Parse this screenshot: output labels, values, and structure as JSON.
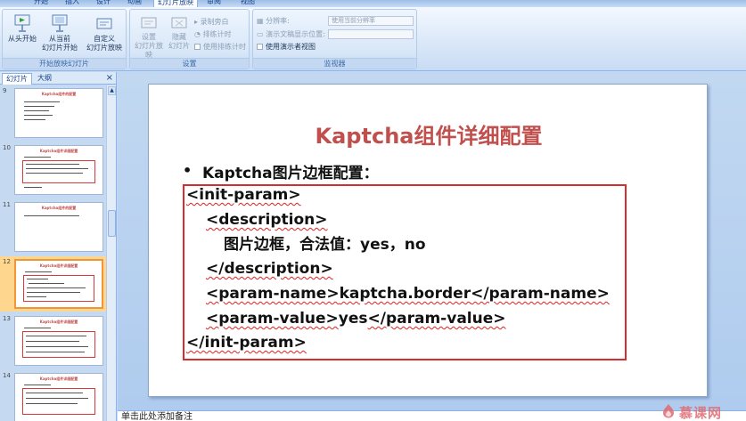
{
  "ribbon_tabs": [
    {
      "label": "开始",
      "active": false
    },
    {
      "label": "插入",
      "active": false
    },
    {
      "label": "设计",
      "active": false
    },
    {
      "label": "动画",
      "active": false
    },
    {
      "label": "幻灯片放映",
      "active": true
    },
    {
      "label": "审阅",
      "active": false
    },
    {
      "label": "视图",
      "active": false
    }
  ],
  "ribbon": {
    "start_group": {
      "label": "开始放映幻灯片",
      "from_beginning": "从头开始",
      "from_current_line1": "从当前",
      "from_current_line2": "幻灯片开始",
      "custom_line1": "自定义",
      "custom_line2": "幻灯片放映"
    },
    "setup_group": {
      "label": "设置",
      "setup_show_line1": "设置",
      "setup_show_line2": "幻灯片放映",
      "hide_slide_line1": "隐藏",
      "hide_slide_line2": "幻灯片",
      "record_narration": "录制旁白",
      "rehearse_timings": "排练计时",
      "use_timings": "使用排练计时"
    },
    "monitors_group": {
      "label": "监视器",
      "resolution_label": "分辨率:",
      "resolution_value": "使用当前分辨率",
      "show_on_label": "演示文稿显示位置:",
      "show_on_value": "",
      "presenter_view": "使用演示者视图"
    }
  },
  "left_pane": {
    "tab_slides": "幻灯片",
    "tab_outline": "大纲",
    "close": "×",
    "thumbnails": [
      {
        "number": "9",
        "title": "Kaptcha组件的配置",
        "selected": false
      },
      {
        "number": "10",
        "title": "Kaptcha组件详细配置",
        "selected": false
      },
      {
        "number": "11",
        "title": "Kaptcha组件的配置",
        "selected": false
      },
      {
        "number": "12",
        "title": "Kaptcha组件详细配置",
        "selected": true
      },
      {
        "number": "13",
        "title": "Kaptcha组件详细配置",
        "selected": false
      },
      {
        "number": "14",
        "title": "Kaptcha组件详细配置",
        "selected": false
      }
    ]
  },
  "slide": {
    "title": "Kaptcha组件详细配置",
    "bullet_symbol": "•",
    "bullet_text": "Kaptcha图片边框配置：",
    "code": {
      "line1": "<init-param>",
      "line2": "<description>",
      "line3": "图片边框，合法值：yes，no",
      "line4": "</description>",
      "line5_open": "<param-name>",
      "line5_value": "kaptcha.border",
      "line5_close": "</param-name>",
      "line6_open": "<param-value>",
      "line6_value": "yes",
      "line6_close": "</param-value>",
      "line7": "</init-param>"
    }
  },
  "notes": {
    "placeholder": "单击此处添加备注"
  },
  "watermark": {
    "text": "慕课网"
  },
  "colors": {
    "slide_title": "#c0504d",
    "code_border": "#d42e2e",
    "selected_thumb": "#ffd68d",
    "ribbon_bg": "#dbe8f8"
  }
}
